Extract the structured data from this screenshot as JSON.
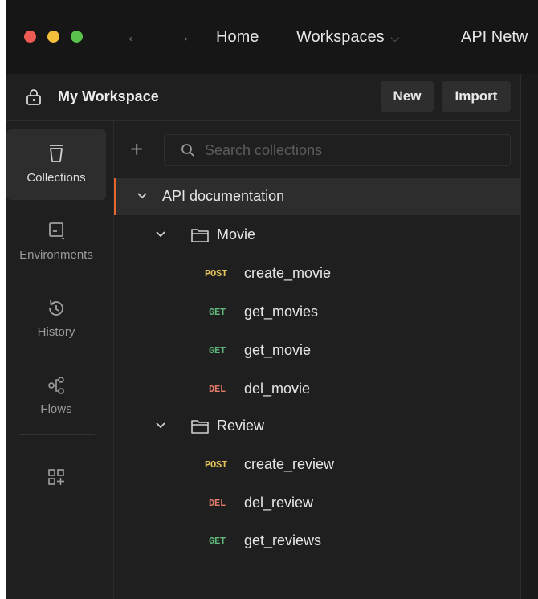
{
  "colors": {
    "post": "#e3c35a",
    "get": "#5fb77b",
    "del": "#e57c6c",
    "accent": "#e5662c"
  },
  "titlebar": {
    "nav_links": [
      "Home",
      "Workspaces",
      "API Netw"
    ],
    "workspaces_caret": "⌵"
  },
  "workspace": {
    "title": "My Workspace",
    "new_label": "New",
    "import_label": "Import"
  },
  "sidebar": {
    "items": [
      {
        "label": "Collections",
        "icon": "collections-icon"
      },
      {
        "label": "Environments",
        "icon": "environments-icon"
      },
      {
        "label": "History",
        "icon": "history-icon"
      },
      {
        "label": "Flows",
        "icon": "flows-icon"
      }
    ],
    "extra_icon": "add-apps-icon"
  },
  "collections": {
    "search_placeholder": "Search collections",
    "collection_name": "API documentation",
    "folders": [
      {
        "name": "Movie",
        "requests": [
          {
            "method": "POST",
            "name": "create_movie"
          },
          {
            "method": "GET",
            "name": "get_movies"
          },
          {
            "method": "GET",
            "name": "get_movie"
          },
          {
            "method": "DEL",
            "name": "del_movie"
          }
        ]
      },
      {
        "name": "Review",
        "requests": [
          {
            "method": "POST",
            "name": "create_review"
          },
          {
            "method": "DEL",
            "name": "del_review"
          },
          {
            "method": "GET",
            "name": "get_reviews"
          }
        ]
      }
    ]
  }
}
